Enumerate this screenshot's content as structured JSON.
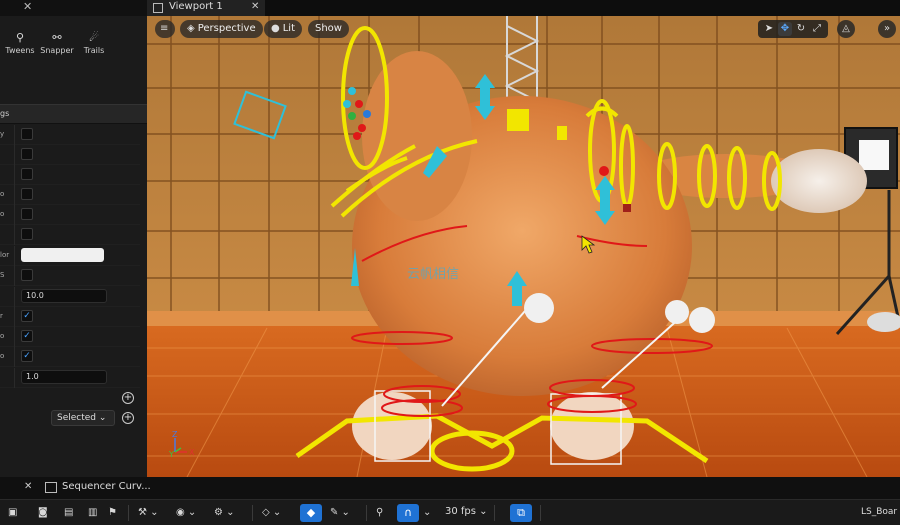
{
  "left_panel": {
    "tools": [
      {
        "label": "Tweens",
        "icon": "tweens-icon"
      },
      {
        "label": "Snapper",
        "icon": "snapper-icon"
      },
      {
        "label": "Trails",
        "icon": "trails-icon"
      }
    ],
    "section_title": "gs",
    "properties": [
      {
        "label": "y",
        "type": "checkbox",
        "checked": false
      },
      {
        "label": "",
        "type": "checkbox",
        "checked": false
      },
      {
        "label": "",
        "type": "checkbox",
        "checked": false
      },
      {
        "label": "o",
        "type": "checkbox",
        "checked": false
      },
      {
        "label": "o",
        "type": "checkbox",
        "checked": false
      },
      {
        "label": "",
        "type": "checkbox",
        "checked": false
      },
      {
        "label": "lor",
        "type": "color",
        "value": "#f0f0f0"
      },
      {
        "label": "S",
        "type": "checkbox",
        "checked": false
      },
      {
        "label": "",
        "type": "number",
        "value": "10.0"
      },
      {
        "label": "r",
        "type": "checkbox",
        "checked": true
      },
      {
        "label": "o",
        "type": "checkbox",
        "checked": true
      },
      {
        "label": "o",
        "type": "checkbox",
        "checked": true
      },
      {
        "label": "",
        "type": "number",
        "value": "1.0"
      }
    ],
    "selected_dropdown": "Selected"
  },
  "viewport": {
    "tab_title": "Viewport 1",
    "perspective_label": "Perspective",
    "lit_label": "Lit",
    "show_label": "Show",
    "watermark": "云帆相信"
  },
  "bottom": {
    "sequencer_tab": "Sequencer Curv...",
    "fps_label": "30 fps",
    "sequence_name": "LS_Boar"
  },
  "colors": {
    "accent_blue": "#1f72d4",
    "gizmo_yellow": "#f2e600",
    "gizmo_cyan": "#2fc0d8",
    "gizmo_red": "#e01818"
  }
}
